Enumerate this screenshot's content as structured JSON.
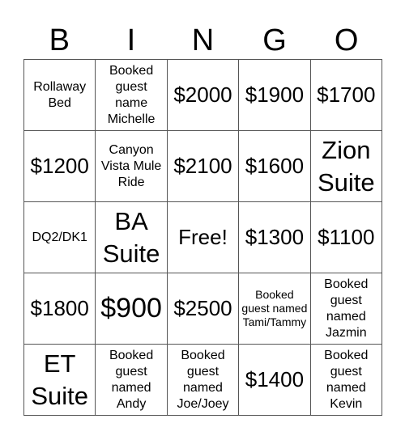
{
  "header": {
    "letters": [
      "B",
      "I",
      "N",
      "G",
      "O"
    ]
  },
  "cells": [
    {
      "text": "Rollaway Bed",
      "size": "s-md"
    },
    {
      "text": "Booked guest name Michelle",
      "size": "s-md"
    },
    {
      "text": "$2000",
      "size": "s-lg"
    },
    {
      "text": "$1900",
      "size": "s-lg"
    },
    {
      "text": "$1700",
      "size": "s-lg"
    },
    {
      "text": "$1200",
      "size": "s-lg"
    },
    {
      "text": "Canyon Vista Mule Ride",
      "size": "s-md"
    },
    {
      "text": "$2100",
      "size": "s-lg"
    },
    {
      "text": "$1600",
      "size": "s-lg"
    },
    {
      "text": "Zion Suite",
      "size": "s-xl"
    },
    {
      "text": "DQ2/DK1",
      "size": "s-md"
    },
    {
      "text": "BA Suite",
      "size": "s-xl"
    },
    {
      "text": "Free!",
      "size": "s-lg"
    },
    {
      "text": "$1300",
      "size": "s-lg"
    },
    {
      "text": "$1100",
      "size": "s-lg"
    },
    {
      "text": "$1800",
      "size": "s-lg"
    },
    {
      "text": "$900",
      "size": "s-xxl"
    },
    {
      "text": "$2500",
      "size": "s-lg"
    },
    {
      "text": "Booked guest named Tami/Tammy",
      "size": "s-sm"
    },
    {
      "text": "Booked guest named Jazmin",
      "size": "s-md"
    },
    {
      "text": "ET Suite",
      "size": "s-xl"
    },
    {
      "text": "Booked guest named Andy",
      "size": "s-md"
    },
    {
      "text": "Booked guest named Joe/Joey",
      "size": "s-md"
    },
    {
      "text": "$1400",
      "size": "s-lg"
    },
    {
      "text": "Booked guest named Kevin",
      "size": "s-md"
    }
  ]
}
